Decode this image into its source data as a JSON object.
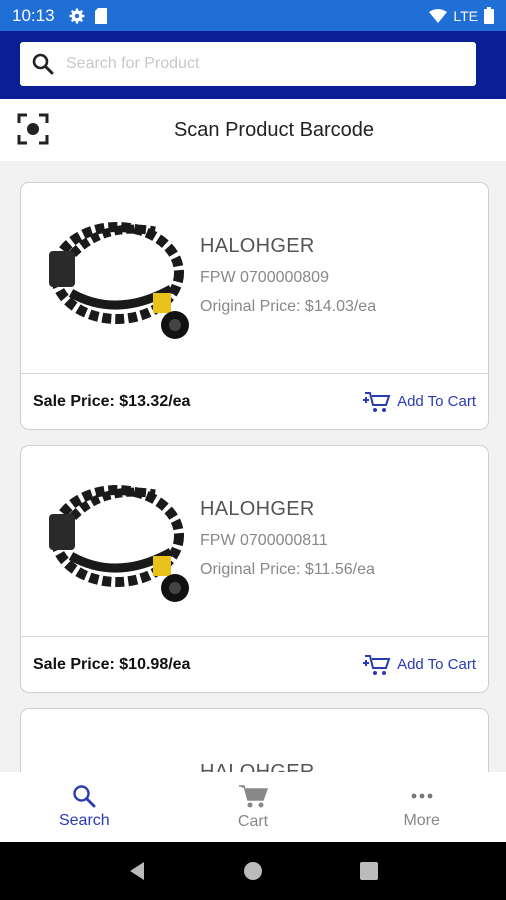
{
  "status_bar": {
    "time": "10:13",
    "network": "LTE"
  },
  "search": {
    "placeholder": "Search for Product",
    "value": ""
  },
  "scan": {
    "label": "Scan Product Barcode"
  },
  "products": [
    {
      "name": "HALOHGER",
      "sku": "FPW 0700000809",
      "original_price": "Original Price: $14.03/ea",
      "sale_price": "Sale Price: $13.32/ea",
      "add_to_cart": "Add To Cart"
    },
    {
      "name": "HALOHGER",
      "sku": "FPW 0700000811",
      "original_price": "Original Price: $11.56/ea",
      "sale_price": "Sale Price: $10.98/ea",
      "add_to_cart": "Add To Cart"
    },
    {
      "name": "HALOHGER"
    }
  ],
  "bottom_nav": [
    {
      "label": "Search",
      "icon": "search-icon",
      "active": true
    },
    {
      "label": "Cart",
      "icon": "cart-icon",
      "active": false
    },
    {
      "label": "More",
      "icon": "more-icon",
      "active": false
    }
  ],
  "colors": {
    "status_bar": "#1f6fd6",
    "header": "#0a1f96",
    "accent": "#2a3bb3"
  }
}
